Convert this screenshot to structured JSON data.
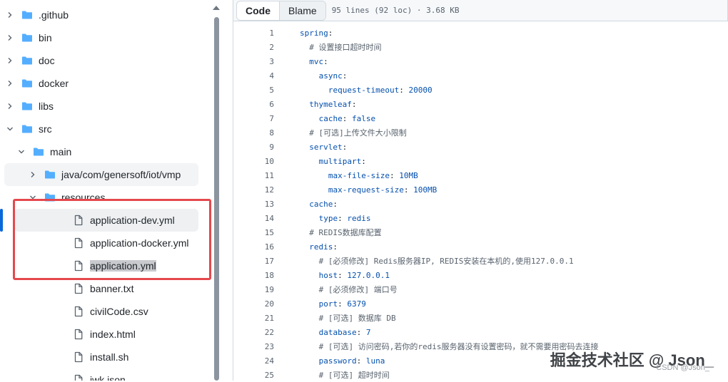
{
  "tree": {
    "items": [
      {
        "label": ".github",
        "type": "folder",
        "expanded": false,
        "indent": 0
      },
      {
        "label": "bin",
        "type": "folder",
        "expanded": false,
        "indent": 0
      },
      {
        "label": "doc",
        "type": "folder",
        "expanded": false,
        "indent": 0
      },
      {
        "label": "docker",
        "type": "folder",
        "expanded": false,
        "indent": 0
      },
      {
        "label": "libs",
        "type": "folder",
        "expanded": false,
        "indent": 0
      },
      {
        "label": "src",
        "type": "folder",
        "expanded": true,
        "indent": 0
      },
      {
        "label": "main",
        "type": "folder",
        "expanded": true,
        "indent": 1
      },
      {
        "label": "java/com/genersoft/iot/vmp",
        "type": "folder",
        "expanded": false,
        "indent": 2
      },
      {
        "label": "resources",
        "type": "folder",
        "expanded": true,
        "indent": 2
      },
      {
        "label": "application-dev.yml",
        "type": "file",
        "indent": 3
      },
      {
        "label": "application-docker.yml",
        "type": "file",
        "indent": 3
      },
      {
        "label": "application.yml",
        "type": "file",
        "indent": 3
      },
      {
        "label": "banner.txt",
        "type": "file",
        "indent": 3
      },
      {
        "label": "civilCode.csv",
        "type": "file",
        "indent": 3
      },
      {
        "label": "index.html",
        "type": "file",
        "indent": 3
      },
      {
        "label": "install.sh",
        "type": "file",
        "indent": 3
      },
      {
        "label": "jwk.json",
        "type": "file",
        "indent": 3
      }
    ]
  },
  "viewer": {
    "tab_code": "Code",
    "tab_blame": "Blame",
    "meta": "95 lines (92 loc) · 3.68 KB"
  },
  "code_lines": [
    {
      "n": "1",
      "indent": 0,
      "key": "spring",
      "sep": ":",
      "val": "",
      "comment": ""
    },
    {
      "n": "2",
      "indent": 1,
      "key": "",
      "sep": "",
      "val": "",
      "comment": "# 设置接口超时时间"
    },
    {
      "n": "3",
      "indent": 1,
      "key": "mvc",
      "sep": ":",
      "val": "",
      "comment": ""
    },
    {
      "n": "4",
      "indent": 2,
      "key": "async",
      "sep": ":",
      "val": "",
      "comment": ""
    },
    {
      "n": "5",
      "indent": 3,
      "key": "request-timeout",
      "sep": ": ",
      "val": "20000",
      "comment": ""
    },
    {
      "n": "6",
      "indent": 1,
      "key": "thymeleaf",
      "sep": ":",
      "val": "",
      "comment": ""
    },
    {
      "n": "7",
      "indent": 2,
      "key": "cache",
      "sep": ": ",
      "val": "false",
      "comment": ""
    },
    {
      "n": "8",
      "indent": 1,
      "key": "",
      "sep": "",
      "val": "",
      "comment": "# [可选]上传文件大小限制"
    },
    {
      "n": "9",
      "indent": 1,
      "key": "servlet",
      "sep": ":",
      "val": "",
      "comment": ""
    },
    {
      "n": "10",
      "indent": 2,
      "key": "multipart",
      "sep": ":",
      "val": "",
      "comment": ""
    },
    {
      "n": "11",
      "indent": 3,
      "key": "max-file-size",
      "sep": ": ",
      "val": "10MB",
      "comment": ""
    },
    {
      "n": "12",
      "indent": 3,
      "key": "max-request-size",
      "sep": ": ",
      "val": "100MB",
      "comment": ""
    },
    {
      "n": "13",
      "indent": 1,
      "key": "cache",
      "sep": ":",
      "val": "",
      "comment": ""
    },
    {
      "n": "14",
      "indent": 2,
      "key": "type",
      "sep": ": ",
      "val": "redis",
      "comment": ""
    },
    {
      "n": "15",
      "indent": 1,
      "key": "",
      "sep": "",
      "val": "",
      "comment": "# REDIS数据库配置"
    },
    {
      "n": "16",
      "indent": 1,
      "key": "redis",
      "sep": ":",
      "val": "",
      "comment": ""
    },
    {
      "n": "17",
      "indent": 2,
      "key": "",
      "sep": "",
      "val": "",
      "comment": "# [必须修改] Redis服务器IP, REDIS安装在本机的,使用127.0.0.1"
    },
    {
      "n": "18",
      "indent": 2,
      "key": "host",
      "sep": ": ",
      "val": "127.0.0.1",
      "comment": ""
    },
    {
      "n": "19",
      "indent": 2,
      "key": "",
      "sep": "",
      "val": "",
      "comment": "# [必须修改] 端口号"
    },
    {
      "n": "20",
      "indent": 2,
      "key": "port",
      "sep": ": ",
      "val": "6379",
      "comment": ""
    },
    {
      "n": "21",
      "indent": 2,
      "key": "",
      "sep": "",
      "val": "",
      "comment": "# [可选] 数据库 DB"
    },
    {
      "n": "22",
      "indent": 2,
      "key": "database",
      "sep": ": ",
      "val": "7",
      "comment": ""
    },
    {
      "n": "23",
      "indent": 2,
      "key": "",
      "sep": "",
      "val": "",
      "comment": "# [可选] 访问密码,若你的redis服务器没有设置密码，就不需要用密码去连接"
    },
    {
      "n": "24",
      "indent": 2,
      "key": "password",
      "sep": ": ",
      "val": "luna",
      "comment": ""
    },
    {
      "n": "25",
      "indent": 2,
      "key": "",
      "sep": "",
      "val": "",
      "comment": "# [可选] 超时时间"
    }
  ],
  "watermark": "掘金技术社区 @ Json_",
  "watermark_small": "CSDN @Json_"
}
